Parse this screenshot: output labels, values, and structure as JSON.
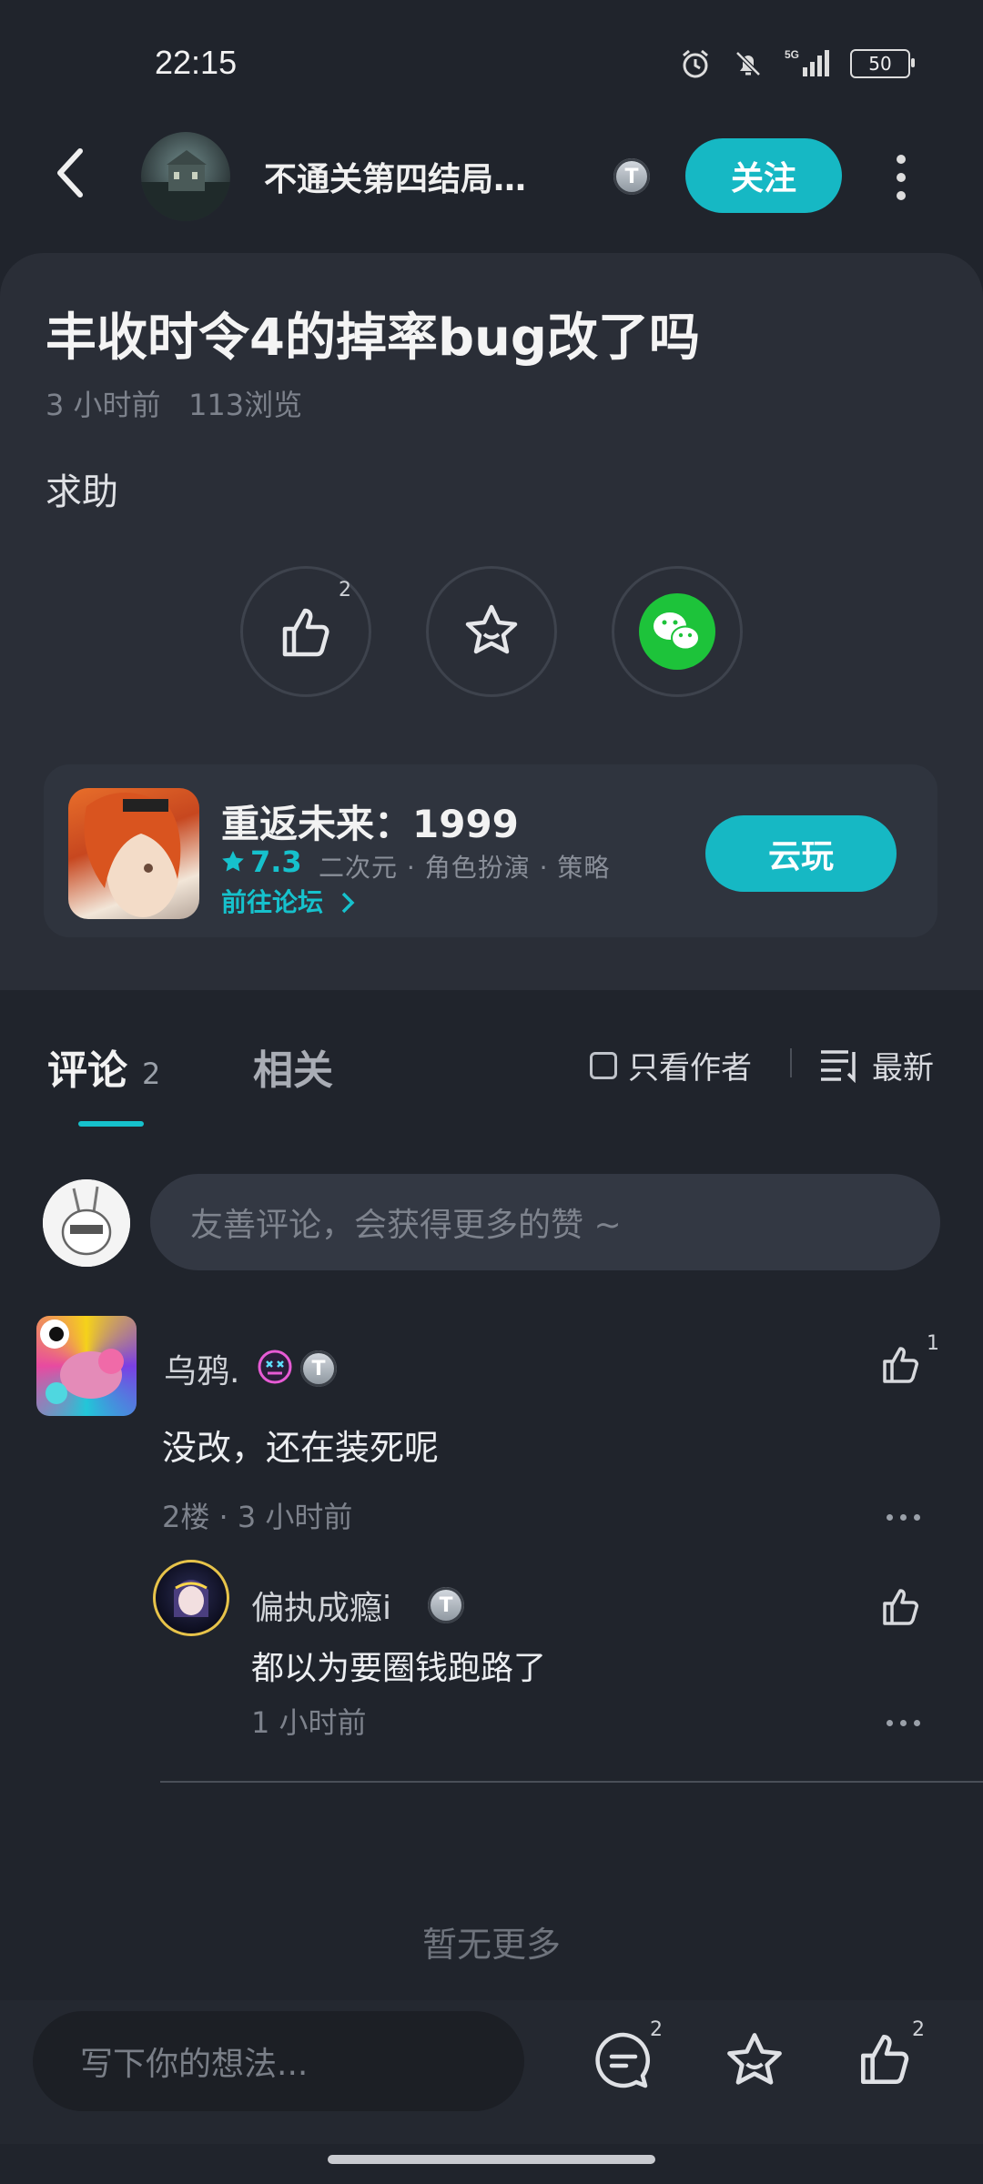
{
  "status_bar": {
    "time": "22:15",
    "network": "5G",
    "battery": "50"
  },
  "header": {
    "title": "不通关第四结局…",
    "level_badge": "T",
    "follow_label": "关注"
  },
  "post": {
    "title": "丰收时令4的掉率bug改了吗",
    "time": "3 小时前",
    "views": "113浏览",
    "body": "求助",
    "like_count": "2"
  },
  "game": {
    "name": "重返未来：1999",
    "rating": "7.3",
    "tags": "二次元 · 角色扮演 · 策略",
    "forum_link": "前往论坛",
    "play_label": "云玩"
  },
  "tabs": {
    "comments_label": "评论",
    "comments_count": "2",
    "related_label": "相关",
    "only_author": "只看作者",
    "sort_label": "最新"
  },
  "comment_input_placeholder": "友善评论，会获得更多的赞 ~",
  "comments": [
    {
      "user": "乌鸦.",
      "text": "没改，还在装死呢",
      "meta": "2楼 · 3 小时前",
      "likes": "1",
      "badge": "T"
    },
    {
      "user": "偏执成瘾i",
      "text": "都以为要圈钱跑路了",
      "meta": "1 小时前",
      "badge": "T"
    }
  ],
  "end_text": "暂无更多",
  "bottom": {
    "placeholder": "写下你的想法...",
    "comment_count": "2",
    "like_count": "2"
  },
  "colors": {
    "accent": "#16b8c4",
    "background": "#20242c",
    "card": "#2a2e37"
  }
}
